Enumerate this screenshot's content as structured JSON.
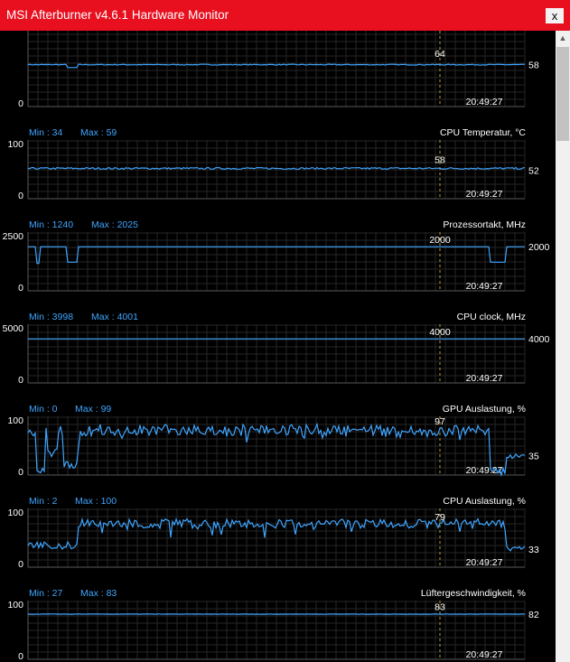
{
  "window": {
    "title": "MSI Afterburner v4.6.1 Hardware Monitor",
    "close_label": "x"
  },
  "graphs": [
    {
      "header": null,
      "ymax_label": null,
      "ymin_label": "0",
      "ymin": 0,
      "ymax": 100,
      "time_label": "20:49:27",
      "cursor_value": "64",
      "current_value": "58",
      "pattern": "flat",
      "base": 58,
      "noise": 0.6,
      "dips": [
        [
          8,
          10,
          54
        ]
      ]
    },
    {
      "header": {
        "min_text": "Min : 34",
        "max_text": "Max : 59",
        "name": "CPU Temperatur, °C"
      },
      "ymax_label": "100",
      "ymin_label": "0",
      "ymin": 0,
      "ymax": 100,
      "time_label": "20:49:27",
      "cursor_value": "58",
      "current_value": "52",
      "pattern": "flat",
      "base": 55,
      "noise": 1.6,
      "dips": []
    },
    {
      "header": {
        "min_text": "Min : 1240",
        "max_text": "Max : 2025",
        "name": "Prozessortakt, MHz"
      },
      "ymax_label": "2500",
      "ymin_label": "0",
      "ymin": 0,
      "ymax": 2500,
      "time_label": "20:49:27",
      "cursor_value": "2000",
      "current_value": "2000",
      "pattern": "flat",
      "base": 2000,
      "noise": 0,
      "dips": [
        [
          1.5,
          2.5,
          1240
        ],
        [
          8,
          10,
          1300
        ],
        [
          93,
          96,
          1300
        ]
      ]
    },
    {
      "header": {
        "min_text": "Min : 3998",
        "max_text": "Max : 4001",
        "name": "CPU clock, MHz"
      },
      "ymax_label": "5000",
      "ymin_label": "0",
      "ymin": 0,
      "ymax": 5000,
      "time_label": "20:49:27",
      "cursor_value": "4000",
      "current_value": "4000",
      "pattern": "flat",
      "base": 4000,
      "noise": 0,
      "dips": []
    },
    {
      "header": {
        "min_text": "Min : 0",
        "max_text": "Max : 99",
        "name": "GPU Auslastung, %"
      },
      "ymax_label": "100",
      "ymin_label": "0",
      "ymin": 0,
      "ymax": 100,
      "time_label": "20:49:27",
      "cursor_value": "97",
      "current_value": "35",
      "pattern": "busy",
      "base": 88,
      "noise": 12,
      "dips": [
        [
          1.5,
          3.5,
          5
        ],
        [
          4,
          6,
          40
        ],
        [
          7,
          10,
          20
        ],
        [
          93,
          96,
          5
        ]
      ],
      "tail": 35
    },
    {
      "header": {
        "min_text": "Min : 2",
        "max_text": "Max : 100",
        "name": "CPU Auslastung, %"
      },
      "ymax_label": "100",
      "ymin_label": "0",
      "ymin": 0,
      "ymax": 100,
      "time_label": "20:49:27",
      "cursor_value": "79",
      "current_value": "33",
      "pattern": "busy",
      "base": 85,
      "noise": 10,
      "dips": [
        [
          0,
          10,
          40
        ]
      ],
      "tail": 33
    },
    {
      "header": {
        "min_text": "Min : 27",
        "max_text": "Max : 83",
        "name": "Lüftergeschwindigkeit, %"
      },
      "ymax_label": "100",
      "ymin_label": "0",
      "ymin": 0,
      "ymax": 100,
      "time_label": "20:49:27",
      "cursor_value": "83",
      "current_value": "82",
      "pattern": "flat",
      "base": 82,
      "noise": 0.3,
      "dips": []
    }
  ],
  "colors": {
    "titlebar": "#e8101f",
    "trace": "#3fa5ff",
    "header": "#3fa5ff",
    "grid": "#262626",
    "label": "#ffffff",
    "cursor": "#b4a040"
  }
}
